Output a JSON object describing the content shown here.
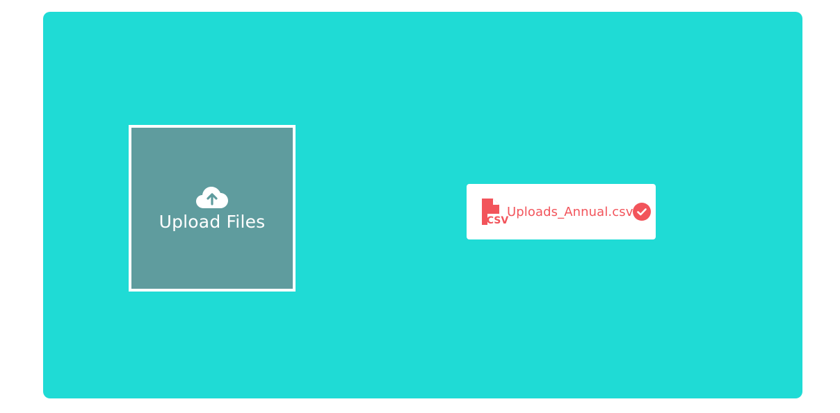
{
  "upload": {
    "label": "Upload Files",
    "icon": "cloud-upload-icon"
  },
  "file": {
    "name": "Uploads_Annual.csv",
    "type_badge": "CSV",
    "file_icon": "csv-file-icon",
    "status_icon": "check-circle-icon"
  },
  "colors": {
    "panel_background": "#1fdbd5",
    "upload_box_background": "#5f9c9e",
    "upload_box_border": "#ffffff",
    "file_accent": "#f2545b",
    "card_background": "#ffffff"
  }
}
